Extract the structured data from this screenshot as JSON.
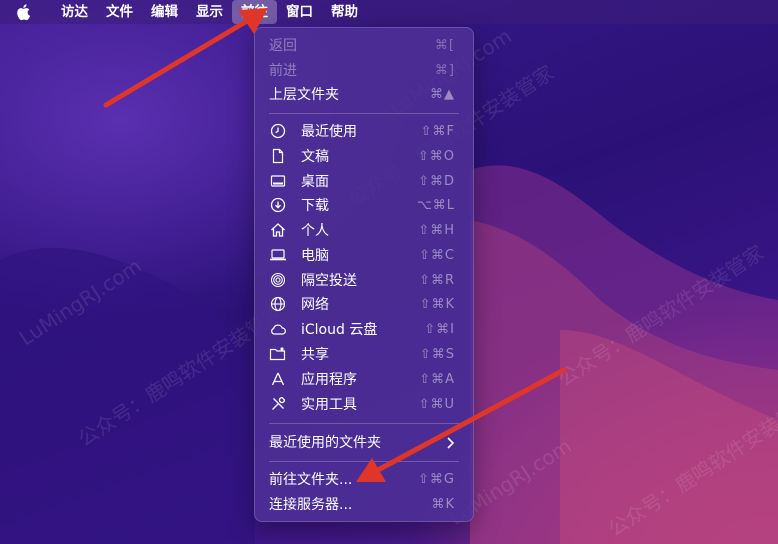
{
  "menubar": {
    "items": [
      {
        "label": "访达"
      },
      {
        "label": "文件"
      },
      {
        "label": "编辑"
      },
      {
        "label": "显示"
      },
      {
        "label": "前往"
      },
      {
        "label": "窗口"
      },
      {
        "label": "帮助"
      }
    ],
    "active_index": 4
  },
  "menu": {
    "items": [
      {
        "label": "返回",
        "shortcut": "⌘[",
        "disabled": true
      },
      {
        "label": "前进",
        "shortcut": "⌘]",
        "disabled": true
      },
      {
        "label": "上层文件夹",
        "shortcut": "⌘▲"
      },
      {
        "label": "最近使用",
        "shortcut": "⇧⌘F",
        "icon": "clock-icon"
      },
      {
        "label": "文稿",
        "shortcut": "⇧⌘O",
        "icon": "document-icon"
      },
      {
        "label": "桌面",
        "shortcut": "⇧⌘D",
        "icon": "desktop-icon"
      },
      {
        "label": "下载",
        "shortcut": "⌥⌘L",
        "icon": "download-icon"
      },
      {
        "label": "个人",
        "shortcut": "⇧⌘H",
        "icon": "home-icon"
      },
      {
        "label": "电脑",
        "shortcut": "⇧⌘C",
        "icon": "laptop-icon"
      },
      {
        "label": "隔空投送",
        "shortcut": "⇧⌘R",
        "icon": "airdrop-icon"
      },
      {
        "label": "网络",
        "shortcut": "⇧⌘K",
        "icon": "globe-icon"
      },
      {
        "label": "iCloud 云盘",
        "shortcut": "⇧⌘I",
        "icon": "cloud-icon"
      },
      {
        "label": "共享",
        "shortcut": "⇧⌘S",
        "icon": "shared-folder-icon"
      },
      {
        "label": "应用程序",
        "shortcut": "⇧⌘A",
        "icon": "applications-icon"
      },
      {
        "label": "实用工具",
        "shortcut": "⇧⌘U",
        "icon": "tools-icon"
      },
      {
        "label": "最近使用的文件夹"
      },
      {
        "label": "前往文件夹...",
        "shortcut": "⇧⌘G"
      },
      {
        "label": "连接服务器...",
        "shortcut": "⌘K"
      }
    ]
  },
  "watermark": {
    "text_en": "LuMingRJ.com",
    "text_cn": "公众号：鹿鸣软件安装管家"
  },
  "colors": {
    "accent": "#e0362a",
    "menu_bg": "#4e3096",
    "wallpaper": "#2a0f6e"
  }
}
